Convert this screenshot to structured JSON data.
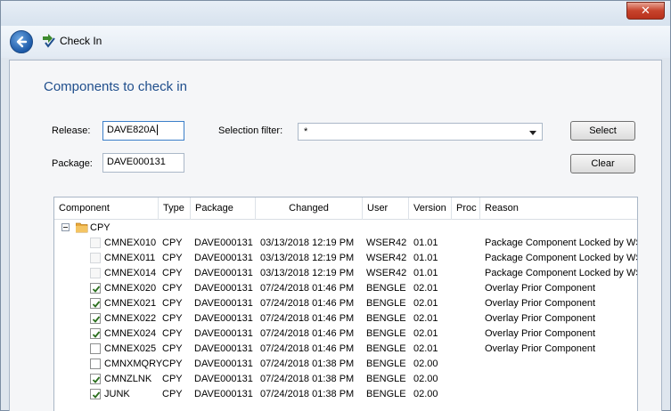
{
  "window": {
    "close_glyph": "✕"
  },
  "toolbar": {
    "title": "Check In"
  },
  "panel": {
    "heading": "Components to check in",
    "release_label": "Release:",
    "release_value": "DAVE820A",
    "package_label": "Package:",
    "package_value": "DAVE000131",
    "filter_label": "Selection filter:",
    "filter_value": "*",
    "select_button": "Select",
    "clear_button": "Clear"
  },
  "grid": {
    "columns": [
      "Component",
      "Type",
      "Package",
      "Changed",
      "User",
      "Version",
      "Proc",
      "Reason"
    ],
    "group": {
      "label": "CPY",
      "expanded": true
    },
    "rows": [
      {
        "checked": false,
        "enabled": false,
        "component": "CMNEX010",
        "type": "CPY",
        "package": "DAVE000131",
        "changed": "03/13/2018  12:19 PM",
        "user": "WSER42",
        "version": "01.01",
        "proc": "",
        "reason": "Package Component Locked by WS"
      },
      {
        "checked": false,
        "enabled": false,
        "component": "CMNEX011",
        "type": "CPY",
        "package": "DAVE000131",
        "changed": "03/13/2018  12:19 PM",
        "user": "WSER42",
        "version": "01.01",
        "proc": "",
        "reason": "Package Component Locked by WS"
      },
      {
        "checked": false,
        "enabled": false,
        "component": "CMNEX014",
        "type": "CPY",
        "package": "DAVE000131",
        "changed": "03/13/2018  12:19 PM",
        "user": "WSER42",
        "version": "01.01",
        "proc": "",
        "reason": "Package Component Locked by WS"
      },
      {
        "checked": true,
        "enabled": true,
        "component": "CMNEX020",
        "type": "CPY",
        "package": "DAVE000131",
        "changed": "07/24/2018  01:46 PM",
        "user": "BENGLE",
        "version": "02.01",
        "proc": "",
        "reason": "Overlay Prior Component"
      },
      {
        "checked": true,
        "enabled": true,
        "component": "CMNEX021",
        "type": "CPY",
        "package": "DAVE000131",
        "changed": "07/24/2018  01:46 PM",
        "user": "BENGLE",
        "version": "02.01",
        "proc": "",
        "reason": "Overlay Prior Component"
      },
      {
        "checked": true,
        "enabled": true,
        "component": "CMNEX022",
        "type": "CPY",
        "package": "DAVE000131",
        "changed": "07/24/2018  01:46 PM",
        "user": "BENGLE",
        "version": "02.01",
        "proc": "",
        "reason": "Overlay Prior Component"
      },
      {
        "checked": true,
        "enabled": true,
        "component": "CMNEX024",
        "type": "CPY",
        "package": "DAVE000131",
        "changed": "07/24/2018  01:46 PM",
        "user": "BENGLE",
        "version": "02.01",
        "proc": "",
        "reason": "Overlay Prior Component"
      },
      {
        "checked": false,
        "enabled": true,
        "component": "CMNEX025",
        "type": "CPY",
        "package": "DAVE000131",
        "changed": "07/24/2018  01:46 PM",
        "user": "BENGLE",
        "version": "02.01",
        "proc": "",
        "reason": "Overlay Prior Component"
      },
      {
        "checked": false,
        "enabled": true,
        "component": "CMNXMQRY",
        "type": "CPY",
        "package": "DAVE000131",
        "changed": "07/24/2018  01:38 PM",
        "user": "BENGLE",
        "version": "02.00",
        "proc": "",
        "reason": ""
      },
      {
        "checked": true,
        "enabled": true,
        "component": "CMNZLNK",
        "type": "CPY",
        "package": "DAVE000131",
        "changed": "07/24/2018  01:38 PM",
        "user": "BENGLE",
        "version": "02.00",
        "proc": "",
        "reason": ""
      },
      {
        "checked": true,
        "enabled": true,
        "component": "JUNK",
        "type": "CPY",
        "package": "DAVE000131",
        "changed": "07/24/2018  01:38 PM",
        "user": "BENGLE",
        "version": "02.00",
        "proc": "",
        "reason": ""
      }
    ]
  },
  "icons": [
    "close-icon",
    "back-arrow-icon",
    "check-in-icon",
    "collapse-icon",
    "folder-icon",
    "checkbox"
  ],
  "colors": {
    "heading": "#1f4e8c",
    "accent": "#1d5aa8",
    "close": "#c7432c"
  }
}
